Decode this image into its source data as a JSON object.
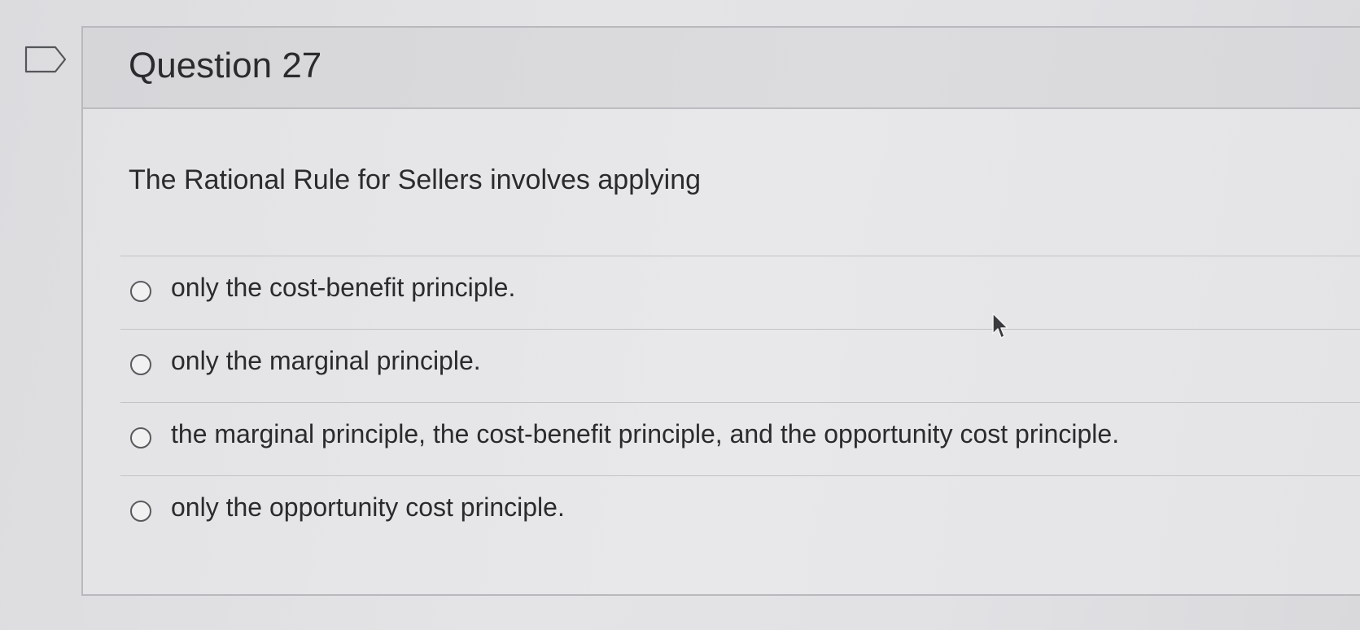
{
  "question": {
    "title": "Question 27",
    "text": "The Rational Rule for Sellers involves applying"
  },
  "answers": [
    {
      "label": "only the cost-benefit principle."
    },
    {
      "label": "only the marginal principle."
    },
    {
      "label": "the marginal principle, the cost-benefit principle, and the opportunity cost principle."
    },
    {
      "label": "only the opportunity cost principle."
    }
  ],
  "icons": {
    "flag": "flag-icon",
    "cursor": "mouse-pointer-icon",
    "radio": "radio-unselected-icon"
  },
  "colors": {
    "text": "#2b2b2e",
    "border": "#b9b9bd",
    "header_bg": "#d8d8db"
  }
}
